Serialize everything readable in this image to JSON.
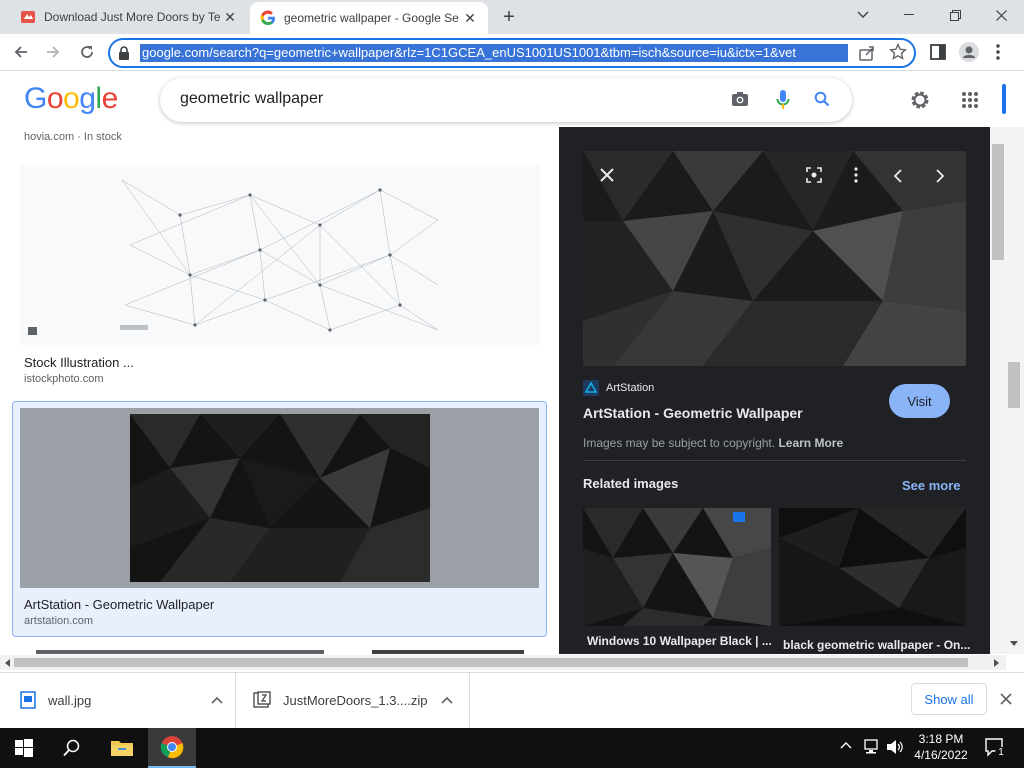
{
  "tabs": [
    {
      "title": "Download Just More Doors by Te",
      "active": false
    },
    {
      "title": "geometric wallpaper - Google Se",
      "active": true
    }
  ],
  "address_bar": {
    "url": "google.com/search?q=geometric+wallpaper&rlz=1C1GCEA_enUS1001US1001&tbm=isch&source=iu&ictx=1&vet"
  },
  "google": {
    "logo": [
      "G",
      "o",
      "o",
      "g",
      "l",
      "e"
    ],
    "logo_colors": [
      "#4285f4",
      "#ea4335",
      "#fbbc05",
      "#4285f4",
      "#34a853",
      "#ea4335"
    ],
    "query": "geometric wallpaper"
  },
  "results": {
    "partial_top": {
      "site": "hovia.com · In stock"
    },
    "items": [
      {
        "title": "Stock Illustration ...",
        "site": "istockphoto.com"
      },
      {
        "title": "ArtStation - Geometric Wallpaper",
        "site": "artstation.com",
        "selected": true
      }
    ]
  },
  "panel": {
    "source_name": "ArtStation",
    "title": "ArtStation - Geometric Wallpaper",
    "visit_label": "Visit",
    "copyright": "Images may be subject to copyright.",
    "learn_more": "Learn More",
    "related_heading": "Related images",
    "see_more": "See more",
    "related": [
      {
        "caption": "Windows 10 Wallpaper Black | ..."
      },
      {
        "caption": "black geometric wallpaper - On..."
      }
    ]
  },
  "downloads": {
    "items": [
      {
        "name": "wall.jpg"
      },
      {
        "name": "JustMoreDoors_1.3....zip"
      }
    ],
    "show_all": "Show all"
  },
  "taskbar": {
    "time": "3:18 PM",
    "date": "4/16/2022",
    "notification_count": "1"
  },
  "colors": {
    "accent": "#1a73e8",
    "visit_button": "#8ab4f8",
    "panel_bg": "#202124",
    "see_more": "#8ab4f8"
  }
}
